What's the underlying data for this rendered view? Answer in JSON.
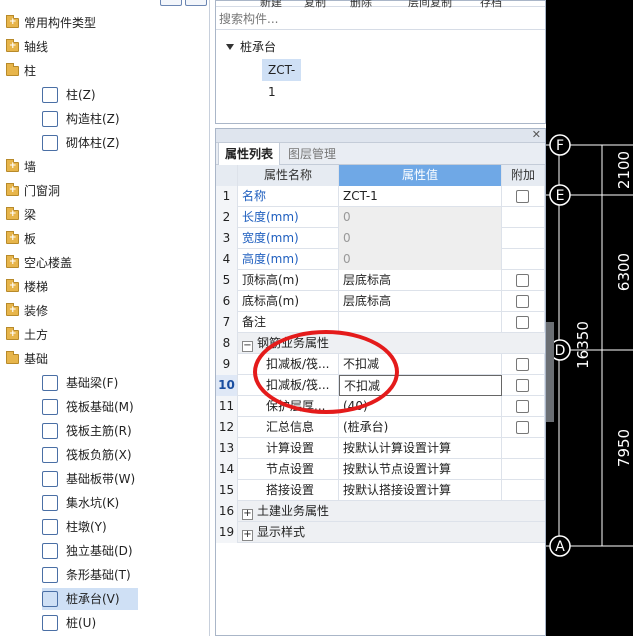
{
  "tree": {
    "categories": [
      {
        "label": "常用构件类型"
      },
      {
        "label": "轴线"
      },
      {
        "label": "柱"
      },
      {
        "label": "墙"
      },
      {
        "label": "门窗洞"
      },
      {
        "label": "梁"
      },
      {
        "label": "板"
      },
      {
        "label": "空心楼盖"
      },
      {
        "label": "楼梯"
      },
      {
        "label": "装修"
      },
      {
        "label": "土方"
      },
      {
        "label": "基础"
      }
    ],
    "column_children": [
      {
        "label": "柱(Z)",
        "icon": "column-icon"
      },
      {
        "label": "构造柱(Z)",
        "icon": "constructional-column-icon"
      },
      {
        "label": "砌体柱(Z)",
        "icon": "masonry-column-icon"
      }
    ],
    "foundation_children": [
      {
        "label": "基础梁(F)",
        "icon": "foundation-beam-icon"
      },
      {
        "label": "筏板基础(M)",
        "icon": "raft-foundation-icon"
      },
      {
        "label": "筏板主筋(R)",
        "icon": "raft-main-rebar-icon"
      },
      {
        "label": "筏板负筋(X)",
        "icon": "raft-negative-rebar-icon"
      },
      {
        "label": "基础板带(W)",
        "icon": "foundation-strip-icon"
      },
      {
        "label": "集水坑(K)",
        "icon": "sump-pit-icon"
      },
      {
        "label": "柱墩(Y)",
        "icon": "column-pier-icon"
      },
      {
        "label": "独立基础(D)",
        "icon": "isolated-footing-icon"
      },
      {
        "label": "条形基础(T)",
        "icon": "strip-footing-icon"
      },
      {
        "label": "桩承台(V)",
        "icon": "pile-cap-icon",
        "selected": true
      },
      {
        "label": "桩(U)",
        "icon": "pile-icon"
      }
    ]
  },
  "toolbar": {
    "items": [
      "新建",
      "复制",
      "删除",
      "层间复制",
      "存档"
    ]
  },
  "component_list": {
    "search_placeholder": "搜索构件...",
    "group": "桩承台",
    "item": "ZCT-1"
  },
  "properties": {
    "tabs": [
      "属性列表",
      "图层管理"
    ],
    "headers": [
      "属性名称",
      "属性值",
      "附加"
    ],
    "rows": [
      {
        "num": "1",
        "name": "名称",
        "value": "ZCT-1",
        "check": true,
        "name_style": "blue"
      },
      {
        "num": "2",
        "name": "长度(mm)",
        "value": "0",
        "check": false,
        "name_style": "blue",
        "disabled": true
      },
      {
        "num": "3",
        "name": "宽度(mm)",
        "value": "0",
        "check": false,
        "name_style": "blue",
        "disabled": true
      },
      {
        "num": "4",
        "name": "高度(mm)",
        "value": "0",
        "check": false,
        "name_style": "blue",
        "disabled": true
      },
      {
        "num": "5",
        "name": "顶标高(m)",
        "value": "层底标高",
        "check": true
      },
      {
        "num": "6",
        "name": "底标高(m)",
        "value": "层底标高",
        "check": true
      },
      {
        "num": "7",
        "name": "备注",
        "value": "",
        "check": true
      },
      {
        "num": "8",
        "name": "钢筋业务属性",
        "value": "",
        "check": false,
        "section": true,
        "expander": "−"
      },
      {
        "num": "9",
        "name": "扣减板/筏...",
        "value": "不扣减",
        "check": true,
        "indent": true
      },
      {
        "num": "10",
        "name": "扣减板/筏...",
        "value": "不扣减",
        "check": true,
        "indent": true,
        "editing": true
      },
      {
        "num": "11",
        "name": "保护层厚...",
        "value": "(40)",
        "check": true,
        "indent": true
      },
      {
        "num": "12",
        "name": "汇总信息",
        "value": "(桩承台)",
        "check": true,
        "indent": true
      },
      {
        "num": "13",
        "name": "计算设置",
        "value": "按默认计算设置计算",
        "check": false,
        "indent": true
      },
      {
        "num": "14",
        "name": "节点设置",
        "value": "按默认节点设置计算",
        "check": false,
        "indent": true
      },
      {
        "num": "15",
        "name": "搭接设置",
        "value": "按默认搭接设置计算",
        "check": false,
        "indent": true
      },
      {
        "num": "16",
        "name": "土建业务属性",
        "value": "",
        "check": false,
        "section": true,
        "expander": "+"
      },
      {
        "num": "19",
        "name": "显示样式",
        "value": "",
        "check": false,
        "section": true,
        "expander": "+"
      }
    ]
  },
  "cad": {
    "axes": [
      "F",
      "E",
      "D",
      "A"
    ],
    "dims": [
      "2100",
      "6300",
      "7950"
    ],
    "total": "16350"
  },
  "colors": {
    "highlight": "#e41b1b",
    "selected": "#cfe0f5",
    "header_accent": "#6fa8e6"
  }
}
